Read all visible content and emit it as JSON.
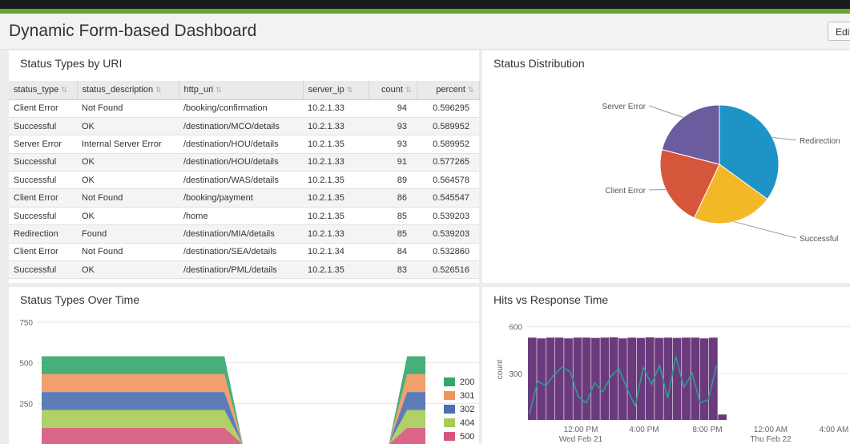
{
  "header": {
    "title": "Dynamic Form-based Dashboard",
    "edit_label": "Edit"
  },
  "colors": {
    "topbar": "#1b1b1b",
    "accent": "#65a637",
    "pie_redirection": "#1e93c6",
    "pie_successful": "#f2b827",
    "pie_client_error": "#d6563c",
    "pie_server_error": "#6a5c9e",
    "hits_bar": "#6b3a7d",
    "response_line": "#2c9c94"
  },
  "table_panel": {
    "title": "Status Types by URI",
    "columns": [
      "status_type",
      "status_description",
      "http_uri",
      "server_ip",
      "count",
      "percent"
    ],
    "rows": [
      [
        "Client Error",
        "Not Found",
        "/booking/confirmation",
        "10.2.1.33",
        "94",
        "0.596295"
      ],
      [
        "Successful",
        "OK",
        "/destination/MCO/details",
        "10.2.1.33",
        "93",
        "0.589952"
      ],
      [
        "Server Error",
        "Internal Server Error",
        "/destination/HOU/details",
        "10.2.1.35",
        "93",
        "0.589952"
      ],
      [
        "Successful",
        "OK",
        "/destination/HOU/details",
        "10.2.1.33",
        "91",
        "0.577265"
      ],
      [
        "Successful",
        "OK",
        "/destination/WAS/details",
        "10.2.1.35",
        "89",
        "0.564578"
      ],
      [
        "Client Error",
        "Not Found",
        "/booking/payment",
        "10.2.1.35",
        "86",
        "0.545547"
      ],
      [
        "Successful",
        "OK",
        "/home",
        "10.2.1.35",
        "85",
        "0.539203"
      ],
      [
        "Redirection",
        "Found",
        "/destination/MIA/details",
        "10.2.1.33",
        "85",
        "0.539203"
      ],
      [
        "Client Error",
        "Not Found",
        "/destination/SEA/details",
        "10.2.1.34",
        "84",
        "0.532860"
      ],
      [
        "Successful",
        "OK",
        "/destination/PML/details",
        "10.2.1.35",
        "83",
        "0.526516"
      ]
    ]
  },
  "pie_panel": {
    "title": "Status Distribution"
  },
  "area_panel": {
    "title": "Status Types Over Time"
  },
  "combo_panel": {
    "title": "Hits vs Response Time"
  },
  "chart_data": [
    {
      "type": "pie",
      "labels": [
        "Redirection",
        "Successful",
        "Client Error",
        "Server Error"
      ],
      "values": [
        35,
        22,
        22,
        21
      ]
    },
    {
      "type": "area",
      "stacked": true,
      "yticks": [
        "250",
        "500",
        "750"
      ],
      "ylim": [
        0,
        750
      ],
      "legend": [
        "200",
        "301",
        "302",
        "404",
        "500"
      ],
      "legend_position": "right",
      "series": [
        {
          "name": "500",
          "color": "#d6567a",
          "values": [
            100,
            100,
            100,
            100,
            100,
            100,
            100,
            100,
            100,
            100,
            100,
            0,
            0,
            0,
            0,
            0,
            0,
            0,
            0,
            0,
            100,
            100
          ]
        },
        {
          "name": "404",
          "color": "#a6cc56",
          "values": [
            110,
            110,
            110,
            110,
            110,
            110,
            110,
            110,
            110,
            110,
            110,
            0,
            0,
            0,
            0,
            0,
            0,
            0,
            0,
            0,
            110,
            110
          ]
        },
        {
          "name": "302",
          "color": "#4a6eb0",
          "values": [
            110,
            110,
            110,
            110,
            110,
            110,
            110,
            110,
            110,
            110,
            110,
            0,
            0,
            0,
            0,
            0,
            0,
            0,
            0,
            0,
            110,
            110
          ]
        },
        {
          "name": "301",
          "color": "#f0955c",
          "values": [
            110,
            110,
            110,
            110,
            110,
            110,
            110,
            110,
            110,
            110,
            110,
            0,
            0,
            0,
            0,
            0,
            0,
            0,
            0,
            0,
            110,
            110
          ]
        },
        {
          "name": "200",
          "color": "#34a66b",
          "values": [
            110,
            110,
            110,
            110,
            110,
            110,
            110,
            110,
            110,
            110,
            110,
            0,
            0,
            0,
            0,
            0,
            0,
            0,
            0,
            0,
            110,
            110
          ]
        }
      ]
    },
    {
      "type": "bar",
      "ylabel": "count",
      "yticks": [
        "300",
        "600"
      ],
      "ylim": [
        0,
        650
      ],
      "xticks": [
        "12:00 PM",
        "4:00 PM",
        "8:00 PM",
        "12:00 AM",
        "4:00 AM"
      ],
      "xsubticks": [
        "Wed Feb 21",
        "",
        "",
        "Thu Feb 22",
        ""
      ],
      "series": [
        {
          "name": "hits",
          "values": [
            530,
            525,
            530,
            530,
            525,
            530,
            530,
            528,
            530,
            532,
            525,
            530,
            528,
            532,
            528,
            530,
            528,
            530,
            530,
            525,
            530,
            35
          ]
        },
        {
          "name": "response_time",
          "values": [
            40,
            250,
            220,
            290,
            340,
            310,
            150,
            110,
            240,
            180,
            280,
            330,
            200,
            90,
            340,
            230,
            350,
            140,
            410,
            210,
            300,
            110,
            130,
            350
          ]
        }
      ]
    }
  ]
}
